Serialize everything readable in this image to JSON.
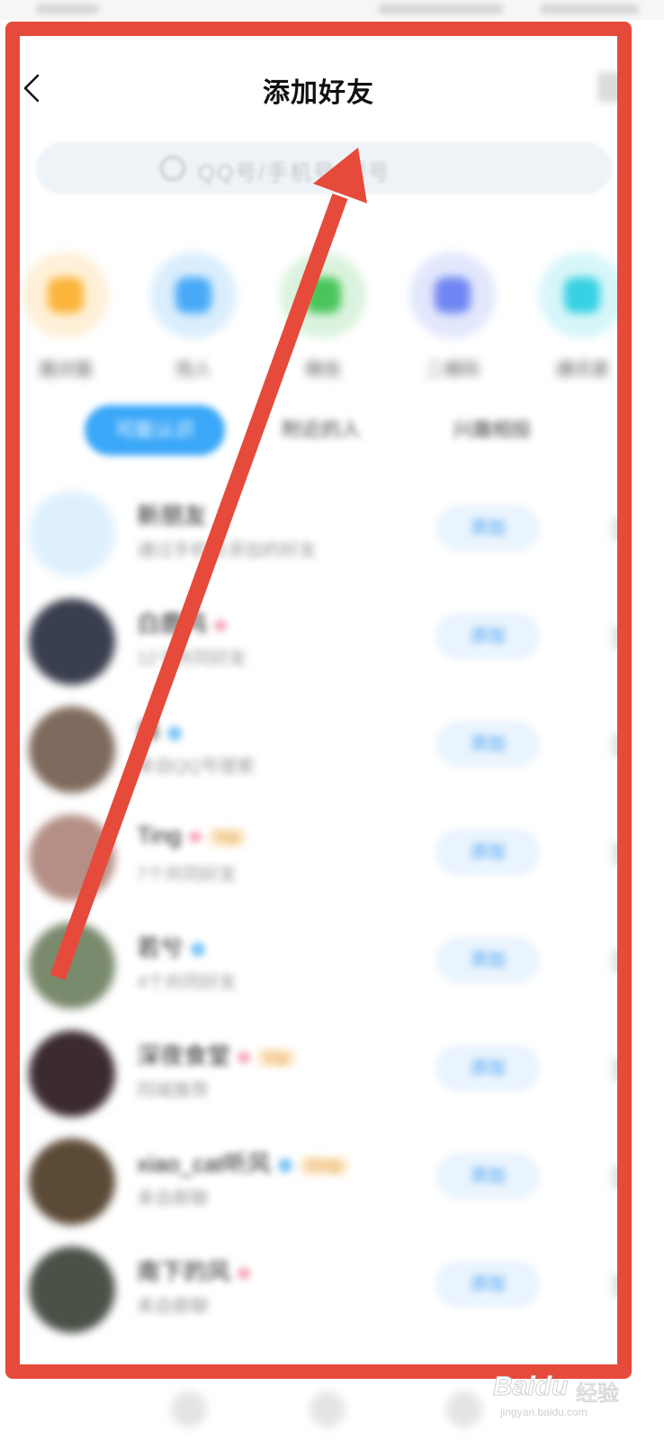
{
  "header": {
    "title": "添加好友"
  },
  "search": {
    "placeholder": "QQ号/手机号/群号"
  },
  "shortcuts": [
    {
      "label": "面对面",
      "color": "#fbb53a",
      "icon": "face-to-face-icon"
    },
    {
      "label": "找人",
      "color": "#47a9f7",
      "icon": "person-icon"
    },
    {
      "label": "微信",
      "color": "#49c55a",
      "icon": "wechat-icon"
    },
    {
      "label": "二维码",
      "color": "#6f86f2",
      "icon": "qrcode-icon"
    },
    {
      "label": "通讯录",
      "color": "#36d1e3",
      "icon": "contacts-icon"
    }
  ],
  "tabs": [
    "可能认识",
    "附近的人",
    "兴趣相投"
  ],
  "add_label": "添加",
  "people": [
    {
      "name": "新朋友",
      "sub": "通过手机号添加的好友",
      "avatar": "#dff0fd"
    },
    {
      "name": "白鹿鸣",
      "sub": "12个共同好友",
      "avatar": "#3a3f4f"
    },
    {
      "name": "林",
      "sub": "来自QQ号搜索",
      "avatar": "#7e6a5d"
    },
    {
      "name": "Ting",
      "sub": "7个共同好友",
      "avatar": "#b58f86",
      "vip": "Vip"
    },
    {
      "name": "若兮",
      "sub": "4个共同好友",
      "avatar": "#7a8a6d"
    },
    {
      "name": "深夜食堂",
      "sub": "同城推荐",
      "avatar": "#3b2a32",
      "vip": "Vip"
    },
    {
      "name": "xiao_cat听风",
      "sub": "来自群聊",
      "avatar": "#5b4a36",
      "vip": "SVip"
    },
    {
      "name": "南下的风",
      "sub": "来自群聊",
      "avatar": "#4a5248"
    }
  ],
  "watermark": {
    "brand": "Baidu",
    "product": "经验",
    "url": "jingyan.baidu.com"
  },
  "colors": {
    "annotation_red": "#e64a3b",
    "accent_blue": "#3aa7f8"
  }
}
